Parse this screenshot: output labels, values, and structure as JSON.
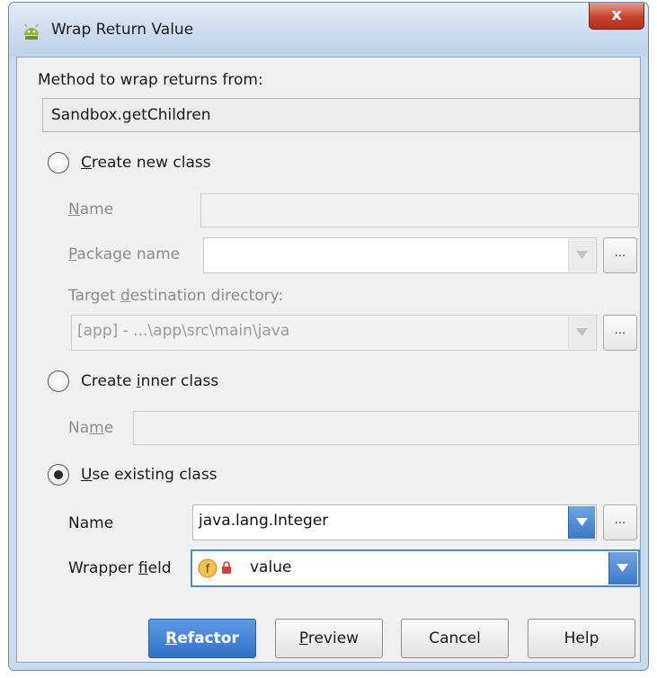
{
  "dialog": {
    "title": "Wrap Return Value",
    "close_glyph": "x",
    "app_icon": "android-icon"
  },
  "method": {
    "label": "Method to wrap returns from:",
    "value": "Sandbox.getChildren"
  },
  "options": {
    "create_new": {
      "label_pre": "",
      "label_u": "C",
      "label_post": "reate new class",
      "selected": false,
      "name_label_pre": "",
      "name_label_u": "N",
      "name_label_post": "ame",
      "name_value": "",
      "package_label_pre": "",
      "package_label_u": "P",
      "package_label_post": "ackage name",
      "package_value": "",
      "dir_label_pre": "Target ",
      "dir_label_u": "d",
      "dir_label_post": "estination directory:",
      "dir_value": "[app] - ...\\app\\src\\main\\java"
    },
    "create_inner": {
      "label_pre": "Create ",
      "label_u": "i",
      "label_post": "nner class",
      "selected": false,
      "name_label_pre": "Na",
      "name_label_u": "m",
      "name_label_post": "e",
      "name_value": ""
    },
    "use_existing": {
      "label_pre": "",
      "label_u": "U",
      "label_post": "se existing class",
      "selected": true,
      "name_label": "Name",
      "name_value": "java.lang.Integer",
      "wrapper_label_pre": "Wrapper ",
      "wrapper_label_u": "f",
      "wrapper_label_post": "ield",
      "wrapper_value": "value",
      "wrapper_icons": [
        "field-icon",
        "lock-icon"
      ]
    }
  },
  "browse_label": "...",
  "buttons": {
    "refactor_u": "R",
    "refactor_post": "efactor",
    "preview_u": "P",
    "preview_post": "review",
    "cancel": "Cancel",
    "help": "Help"
  },
  "colors": {
    "accent": "#3e78c9",
    "title_bar": "#c9dbee",
    "close": "#c8432b"
  }
}
